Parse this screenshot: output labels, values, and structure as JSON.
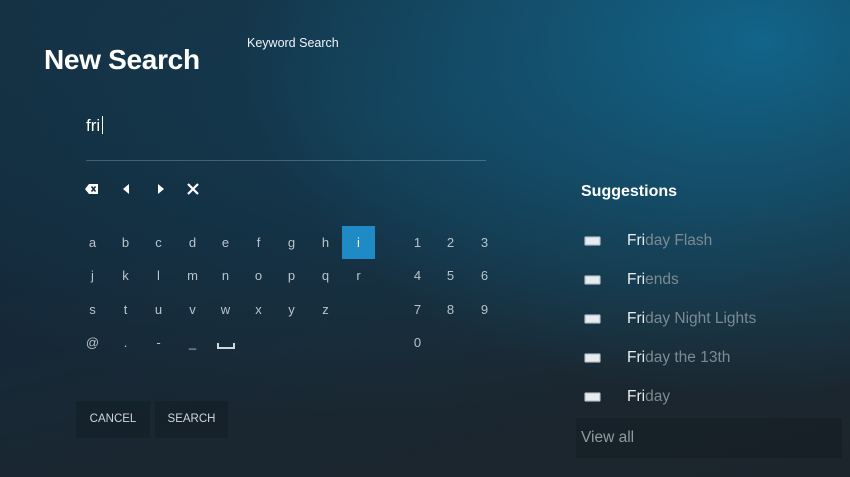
{
  "header": {
    "title": "New Search",
    "subtitle": "Keyword Search"
  },
  "search": {
    "query": "fri"
  },
  "controls": [
    {
      "name": "backspace-icon"
    },
    {
      "name": "cursor-left-icon"
    },
    {
      "name": "cursor-right-icon"
    },
    {
      "name": "clear-icon"
    }
  ],
  "keyboard": {
    "selected_key": "i",
    "letters_row1": [
      "a",
      "b",
      "c",
      "d",
      "e",
      "f",
      "g",
      "h",
      "i"
    ],
    "letters_row2": [
      "j",
      "k",
      "l",
      "m",
      "n",
      "o",
      "p",
      "q",
      "r"
    ],
    "letters_row3": [
      "s",
      "t",
      "u",
      "v",
      "w",
      "x",
      "y",
      "z"
    ],
    "symbols": [
      "@",
      ".",
      "-",
      "_"
    ],
    "space_icon": "space-bar-icon",
    "numbers_row1": [
      "1",
      "2",
      "3"
    ],
    "numbers_row2": [
      "4",
      "5",
      "6"
    ],
    "numbers_row3": [
      "7",
      "8",
      "9"
    ],
    "numbers_row4": [
      "0"
    ]
  },
  "buttons": {
    "cancel": "CANCEL",
    "search": "SEARCH"
  },
  "suggestions": {
    "title": "Suggestions",
    "icon": "tv-icon",
    "items": [
      {
        "match": "Fri",
        "rest": "day Flash"
      },
      {
        "match": "Fri",
        "rest": "ends"
      },
      {
        "match": "Fri",
        "rest": "day Night Lights"
      },
      {
        "match": "Fri",
        "rest": "day the 13th"
      },
      {
        "match": "Fri",
        "rest": "day"
      }
    ],
    "view_all": "View all"
  },
  "colors": {
    "accent": "#1f8bc6",
    "text_dim": "#7d8a92",
    "text": "#e8eef2"
  }
}
